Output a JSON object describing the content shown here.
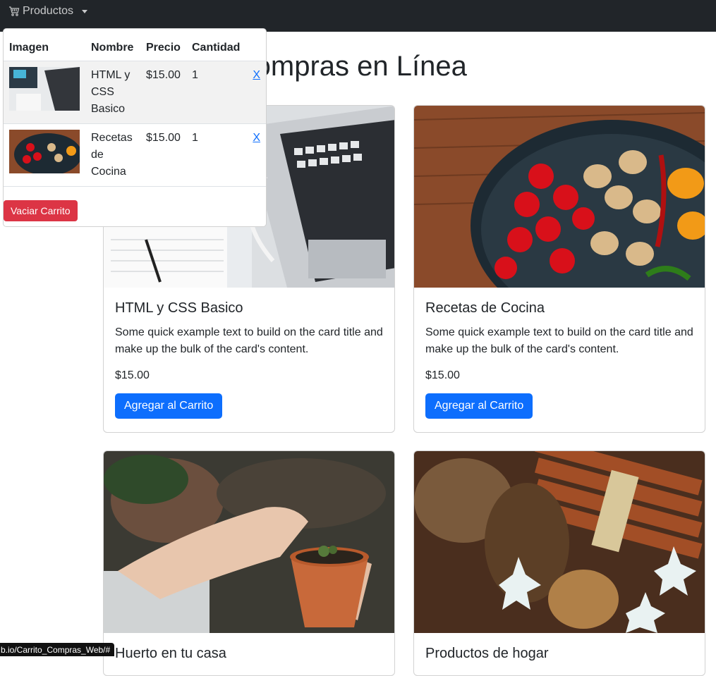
{
  "navbar": {
    "brand": "Productos",
    "icon": "cart-icon"
  },
  "page": {
    "title": "Carrito de Compras en Línea"
  },
  "cart": {
    "headers": [
      "Imagen",
      "Nombre",
      "Precio",
      "Cantidad"
    ],
    "items": [
      {
        "name": "HTML y CSS Basico",
        "price": "$15.00",
        "qty": "1",
        "remove": "X"
      },
      {
        "name": "Recetas de Cocina",
        "price": "$15.00",
        "qty": "1",
        "remove": "X"
      }
    ],
    "empty_label": "Vaciar Carrito"
  },
  "cards": [
    {
      "title": "HTML y CSS Basico",
      "text": "Some quick example text to build on the card title and make up the bulk of the card's content.",
      "price": "$15.00",
      "button": "Agregar al Carrito"
    },
    {
      "title": "Recetas de Cocina",
      "text": "Some quick example text to build on the card title and make up the bulk of the card's content.",
      "price": "$15.00",
      "button": "Agregar al Carrito"
    },
    {
      "title": "Huerto en tu casa"
    },
    {
      "title": "Productos de hogar"
    }
  ],
  "status_bar": {
    "url": "b.io/Carrito_Compras_Web/#"
  },
  "colors": {
    "primary": "#0d6efd",
    "danger": "#dc3545",
    "navbar": "#212529"
  }
}
